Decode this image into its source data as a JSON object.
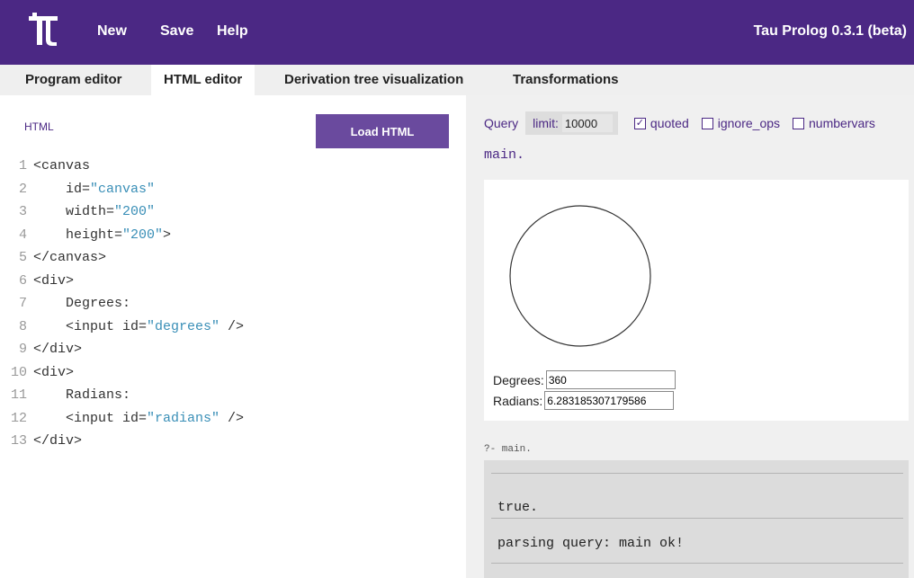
{
  "header": {
    "logo": "tau-logo-icon",
    "menu": {
      "new": "New",
      "save": "Save",
      "help": "Help"
    },
    "version": "Tau Prolog 0.3.1 (beta)",
    "color": "#4b2884"
  },
  "tabs": {
    "program": "Program editor",
    "html": "HTML editor",
    "tree": "Derivation tree visualization",
    "transform": "Transformations",
    "active": "HTML editor"
  },
  "editor": {
    "label": "HTML",
    "load_button": "Load HTML",
    "lines": [
      {
        "n": "1",
        "pre": "<canvas",
        "str": "",
        "post": ""
      },
      {
        "n": "2",
        "pre": "    id=",
        "str": "\"canvas\"",
        "post": ""
      },
      {
        "n": "3",
        "pre": "    width=",
        "str": "\"200\"",
        "post": ""
      },
      {
        "n": "4",
        "pre": "    height=",
        "str": "\"200\"",
        "post": ">"
      },
      {
        "n": "5",
        "pre": "</canvas>",
        "str": "",
        "post": ""
      },
      {
        "n": "6",
        "pre": "<div>",
        "str": "",
        "post": ""
      },
      {
        "n": "7",
        "pre": "    Degrees:",
        "str": "",
        "post": ""
      },
      {
        "n": "8",
        "pre": "    <input id=",
        "str": "\"degrees\"",
        "post": " />"
      },
      {
        "n": "9",
        "pre": "</div>",
        "str": "",
        "post": ""
      },
      {
        "n": "10",
        "pre": "<div>",
        "str": "",
        "post": ""
      },
      {
        "n": "11",
        "pre": "    Radians:",
        "str": "",
        "post": ""
      },
      {
        "n": "12",
        "pre": "    <input id=",
        "str": "\"radians\"",
        "post": " />"
      },
      {
        "n": "13",
        "pre": "</div>",
        "str": "",
        "post": ""
      }
    ]
  },
  "query": {
    "label": "Query",
    "limit_label": "limit:",
    "limit_value": "10000",
    "options": {
      "quoted": {
        "label": "quoted",
        "checked": true
      },
      "ignore_ops": {
        "label": "ignore_ops",
        "checked": false
      },
      "numbervars": {
        "label": "numbervars",
        "checked": false
      }
    },
    "text": "main."
  },
  "output": {
    "degrees_label": "Degrees:",
    "degrees_value": "360",
    "radians_label": "Radians:",
    "radians_value": "6.283185307179586"
  },
  "history": {
    "query": "?- main.",
    "answers": [
      "true.",
      "parsing query: main ok!"
    ]
  }
}
